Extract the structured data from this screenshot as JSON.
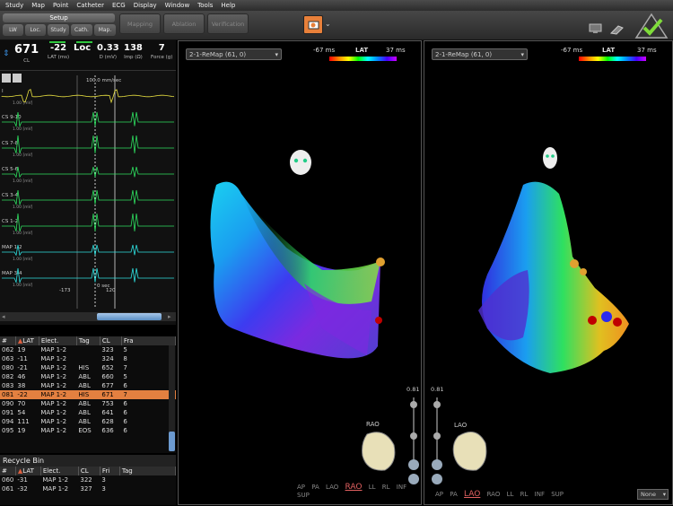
{
  "menu": [
    "Study",
    "Map",
    "Point",
    "Catheter",
    "ECG",
    "Display",
    "Window",
    "Tools",
    "Help"
  ],
  "toolbar": {
    "setup": "Setup",
    "sub_tabs": [
      "LW",
      "Loc.",
      "Study",
      "Cath.",
      "Map."
    ],
    "workflow": [
      "Mapping",
      "Ablation",
      "Verification"
    ]
  },
  "vitals": [
    {
      "value": "671",
      "label": "CL"
    },
    {
      "value": "-22",
      "label": "LAT (ms)"
    },
    {
      "value": "Loc",
      "label": ""
    },
    {
      "value": "0.33",
      "label": "D (mV)"
    },
    {
      "value": "138",
      "label": "Imp (Ω)"
    },
    {
      "value": "7",
      "label": "Force (g)"
    }
  ],
  "ecg": {
    "speed": "100.0 mm/sec",
    "leads": [
      {
        "name": "I",
        "scale": "1.00 [mV]"
      },
      {
        "name": "CS 9-10",
        "scale": "1.00 [mV]"
      },
      {
        "name": "CS 7-8",
        "scale": "1.00 [mV]"
      },
      {
        "name": "CS 5-6",
        "scale": "1.00 [mV]"
      },
      {
        "name": "CS 3-4",
        "scale": "1.00 [mV]"
      },
      {
        "name": "CS 1-2",
        "scale": "1.00 [mV]"
      },
      {
        "name": "MAP 1-2",
        "scale": "1.00 [mV]"
      },
      {
        "name": "MAP 3-4",
        "scale": "1.00 [mV]"
      }
    ],
    "marker_left": "-173",
    "marker_right": "120",
    "marker_mid": "0 sec",
    "mv_label": "[mV]"
  },
  "points_table": {
    "headers": [
      "#",
      "LAT",
      "Elect.",
      "Tag",
      "CL",
      "Fra"
    ],
    "rows": [
      [
        "062",
        "19",
        "MAP 1-2",
        "",
        "323",
        "5"
      ],
      [
        "063",
        "-11",
        "MAP 1-2",
        "",
        "324",
        "8"
      ],
      [
        "080",
        "-21",
        "MAP 1-2",
        "HIS",
        "652",
        "7"
      ],
      [
        "082",
        "46",
        "MAP 1-2",
        "ABL",
        "660",
        "5"
      ],
      [
        "083",
        "38",
        "MAP 1-2",
        "ABL",
        "677",
        "6"
      ],
      [
        "081",
        "-22",
        "MAP 1-2",
        "HIS",
        "671",
        "7"
      ],
      [
        "090",
        "70",
        "MAP 1-2",
        "ABL",
        "753",
        "6"
      ],
      [
        "091",
        "54",
        "MAP 1-2",
        "ABL",
        "641",
        "6"
      ],
      [
        "094",
        "111",
        "MAP 1-2",
        "ABL",
        "628",
        "6"
      ],
      [
        "095",
        "19",
        "MAP 1-2",
        "EOS",
        "636",
        "6"
      ]
    ],
    "selected_index": 5
  },
  "recycle_bin": {
    "title": "Recycle Bin",
    "headers": [
      "#",
      "LAT",
      "Elect.",
      "CL",
      "Fri",
      "Tag"
    ],
    "rows": [
      [
        "060",
        "-31",
        "MAP 1-2",
        "322",
        "3",
        ""
      ],
      [
        "061",
        "-32",
        "MAP 1-2",
        "327",
        "3",
        ""
      ]
    ]
  },
  "maps": [
    {
      "map_select": "2-1-ReMap (61, 0)",
      "colorbar": {
        "min": "-67 ms",
        "title": "LAT",
        "max": "37 ms"
      },
      "orientation": "RAO",
      "opacity": "0.81",
      "views": [
        "AP",
        "PA",
        "LAO",
        "RAO",
        "LL",
        "RL",
        "INF",
        "SUP"
      ],
      "active_view": "RAO"
    },
    {
      "map_select": "2-1-ReMap (61, 0)",
      "colorbar": {
        "min": "-67 ms",
        "title": "LAT",
        "max": "37 ms"
      },
      "orientation": "LAO",
      "opacity": "0.81",
      "views": [
        "AP",
        "PA",
        "LAO",
        "RAO",
        "LL",
        "RL",
        "INF",
        "SUP"
      ],
      "active_view": "LAO",
      "display_select": "None"
    }
  ]
}
